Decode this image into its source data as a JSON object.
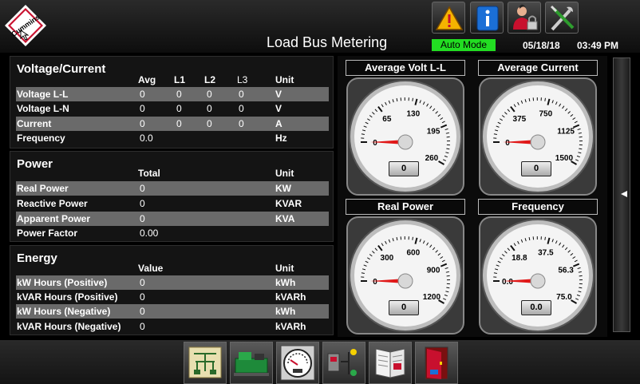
{
  "header": {
    "logo_text": "Cummins",
    "title": "Load Bus Metering",
    "mode": "Auto Mode",
    "date": "05/18/18",
    "time": "03:49 PM",
    "buttons": [
      "warning-icon",
      "info-icon",
      "user-login-icon",
      "tools-icon"
    ]
  },
  "voltage_current": {
    "title": "Voltage/Current",
    "columns": [
      "Avg",
      "L1",
      "L2",
      "L3",
      "Unit"
    ],
    "rows": [
      {
        "label": "Voltage L-L",
        "avg": "0",
        "l1": "0",
        "l2": "0",
        "l3": "0",
        "unit": "V"
      },
      {
        "label": "Voltage L-N",
        "avg": "0",
        "l1": "0",
        "l2": "0",
        "l3": "0",
        "unit": "V"
      },
      {
        "label": "Current",
        "avg": "0",
        "l1": "0",
        "l2": "0",
        "l3": "0",
        "unit": "A"
      },
      {
        "label": "Frequency",
        "avg": "0.0",
        "unit": "Hz"
      }
    ]
  },
  "power": {
    "title": "Power",
    "columns": [
      "Total",
      "Unit"
    ],
    "rows": [
      {
        "label": "Real Power",
        "value": "0",
        "unit": "KW"
      },
      {
        "label": "Reactive Power",
        "value": "0",
        "unit": "KVAR"
      },
      {
        "label": "Apparent Power",
        "value": "0",
        "unit": "KVA"
      },
      {
        "label": "Power Factor",
        "value": "0.00",
        "unit": ""
      }
    ]
  },
  "energy": {
    "title": "Energy",
    "columns": [
      "Value",
      "Unit"
    ],
    "rows": [
      {
        "label": "kW Hours (Positive)",
        "value": "0",
        "unit": "kWh"
      },
      {
        "label": "kVAR Hours (Positive)",
        "value": "0",
        "unit": "kVARh"
      },
      {
        "label": "kW Hours (Negative)",
        "value": "0",
        "unit": "kWh"
      },
      {
        "label": "kVAR Hours (Negative)",
        "value": "0",
        "unit": "kVARh"
      }
    ]
  },
  "gauges": [
    {
      "title": "Average Volt L-L",
      "ticks": [
        "0",
        "65",
        "130",
        "195",
        "260"
      ],
      "max": 260,
      "value": 0,
      "readout": "0"
    },
    {
      "title": "Average Current",
      "ticks": [
        "0",
        "375",
        "750",
        "1125",
        "1500"
      ],
      "max": 1500,
      "value": 0,
      "readout": "0"
    },
    {
      "title": "Real Power",
      "ticks": [
        "0",
        "300",
        "600",
        "900",
        "1200"
      ],
      "max": 1200,
      "value": 0,
      "readout": "0"
    },
    {
      "title": "Frequency",
      "ticks": [
        "0.0",
        "18.8",
        "37.5",
        "56.3",
        "75.0"
      ],
      "max": 75,
      "value": 0,
      "readout": "0.0"
    }
  ],
  "footer": {
    "nav": [
      "one-line-diagram-icon",
      "generator-icon",
      "metering-gauge-icon",
      "transfer-switch-icon",
      "event-log-icon",
      "exit-door-icon"
    ]
  },
  "colors": {
    "mode_green": "#22dd22",
    "needle_red": "#e01818",
    "row_shade": "#6a6a6a",
    "warning_yellow": "#f5b400",
    "info_blue": "#1b6fd6"
  }
}
